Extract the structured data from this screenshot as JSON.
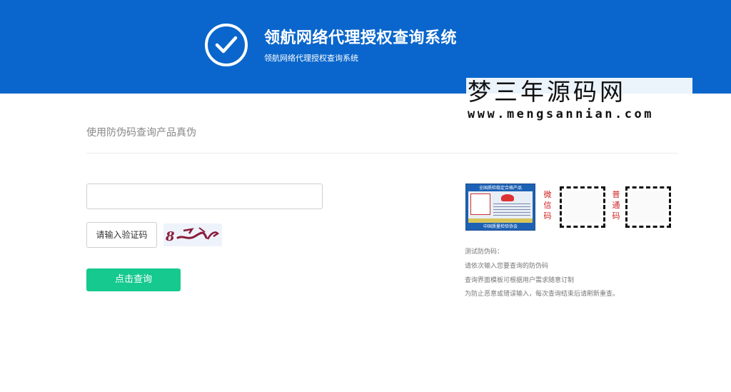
{
  "header": {
    "title": "领航网络代理授权查询系统",
    "subtitle": "领航网络代理授权查询系统"
  },
  "watermark": {
    "line1": "梦三年源码网",
    "line2": "www.mengsannian.com"
  },
  "main": {
    "section_title": "使用防伪码查询产品真伪",
    "code_input_value": "",
    "code_input_placeholder": "",
    "captcha_button_label": "请输入验证码",
    "query_button_label": "点击查询"
  },
  "side": {
    "cert_top_text": "全国质检稳定合格产品",
    "cert_bottom_text": "中国质量检验协会",
    "wechat_label": [
      "微",
      "信",
      "码"
    ],
    "normal_label": [
      "普",
      "通",
      "码"
    ],
    "info_lines": [
      "测试防伪码：",
      "请依次输入您要查询的防伪码",
      "查询界面模板可根据用户需求随意订制",
      "为防止恶意或错误输入，每次查询结束后请刷新重查。"
    ]
  },
  "colors": {
    "header_bg": "#0a66cc",
    "query_button": "#16c98e",
    "label_red": "#d02020"
  }
}
